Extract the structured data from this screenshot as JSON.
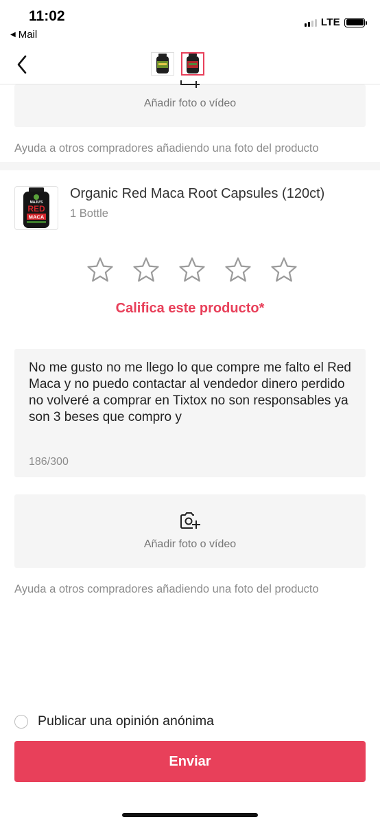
{
  "status_bar": {
    "time": "11:02",
    "back_app": "Mail",
    "network": "LTE"
  },
  "header": {
    "back_icon": "chevron-left-icon",
    "thumbnails": [
      {
        "name": "product-thumbnail-1",
        "active": false
      },
      {
        "name": "product-thumbnail-2",
        "active": true
      }
    ]
  },
  "top_upload": {
    "label": "Añadir foto o vídeo",
    "help": "Ayuda a otros compradores añadiendo una foto del producto"
  },
  "product": {
    "name": "Organic Red Maca Root Capsules (120ct)",
    "variant": "1 Bottle",
    "image_text": {
      "brand": "MAJU'S",
      "line1": "RED",
      "line2": "MACA"
    }
  },
  "rating": {
    "stars": 5,
    "selected": 0,
    "prompt": "Califica este producto*"
  },
  "review": {
    "text": "No me gusto no me llego lo que compre me falto el Red Maca y no puedo contactar al vendedor dinero perdido no volveré a comprar en Tixtox no son responsables ya son 3 beses que compro y",
    "char_count": "186/300"
  },
  "bottom_upload": {
    "icon": "camera-plus-icon",
    "label": "Añadir foto o vídeo",
    "help": "Ayuda a otros compradores añadiendo una foto del producto"
  },
  "anonymous": {
    "label": "Publicar una opinión anónima",
    "checked": false
  },
  "submit_label": "Enviar",
  "colors": {
    "accent": "#e8405a",
    "panel": "#f5f5f5",
    "muted_text": "#8c8c8c"
  }
}
